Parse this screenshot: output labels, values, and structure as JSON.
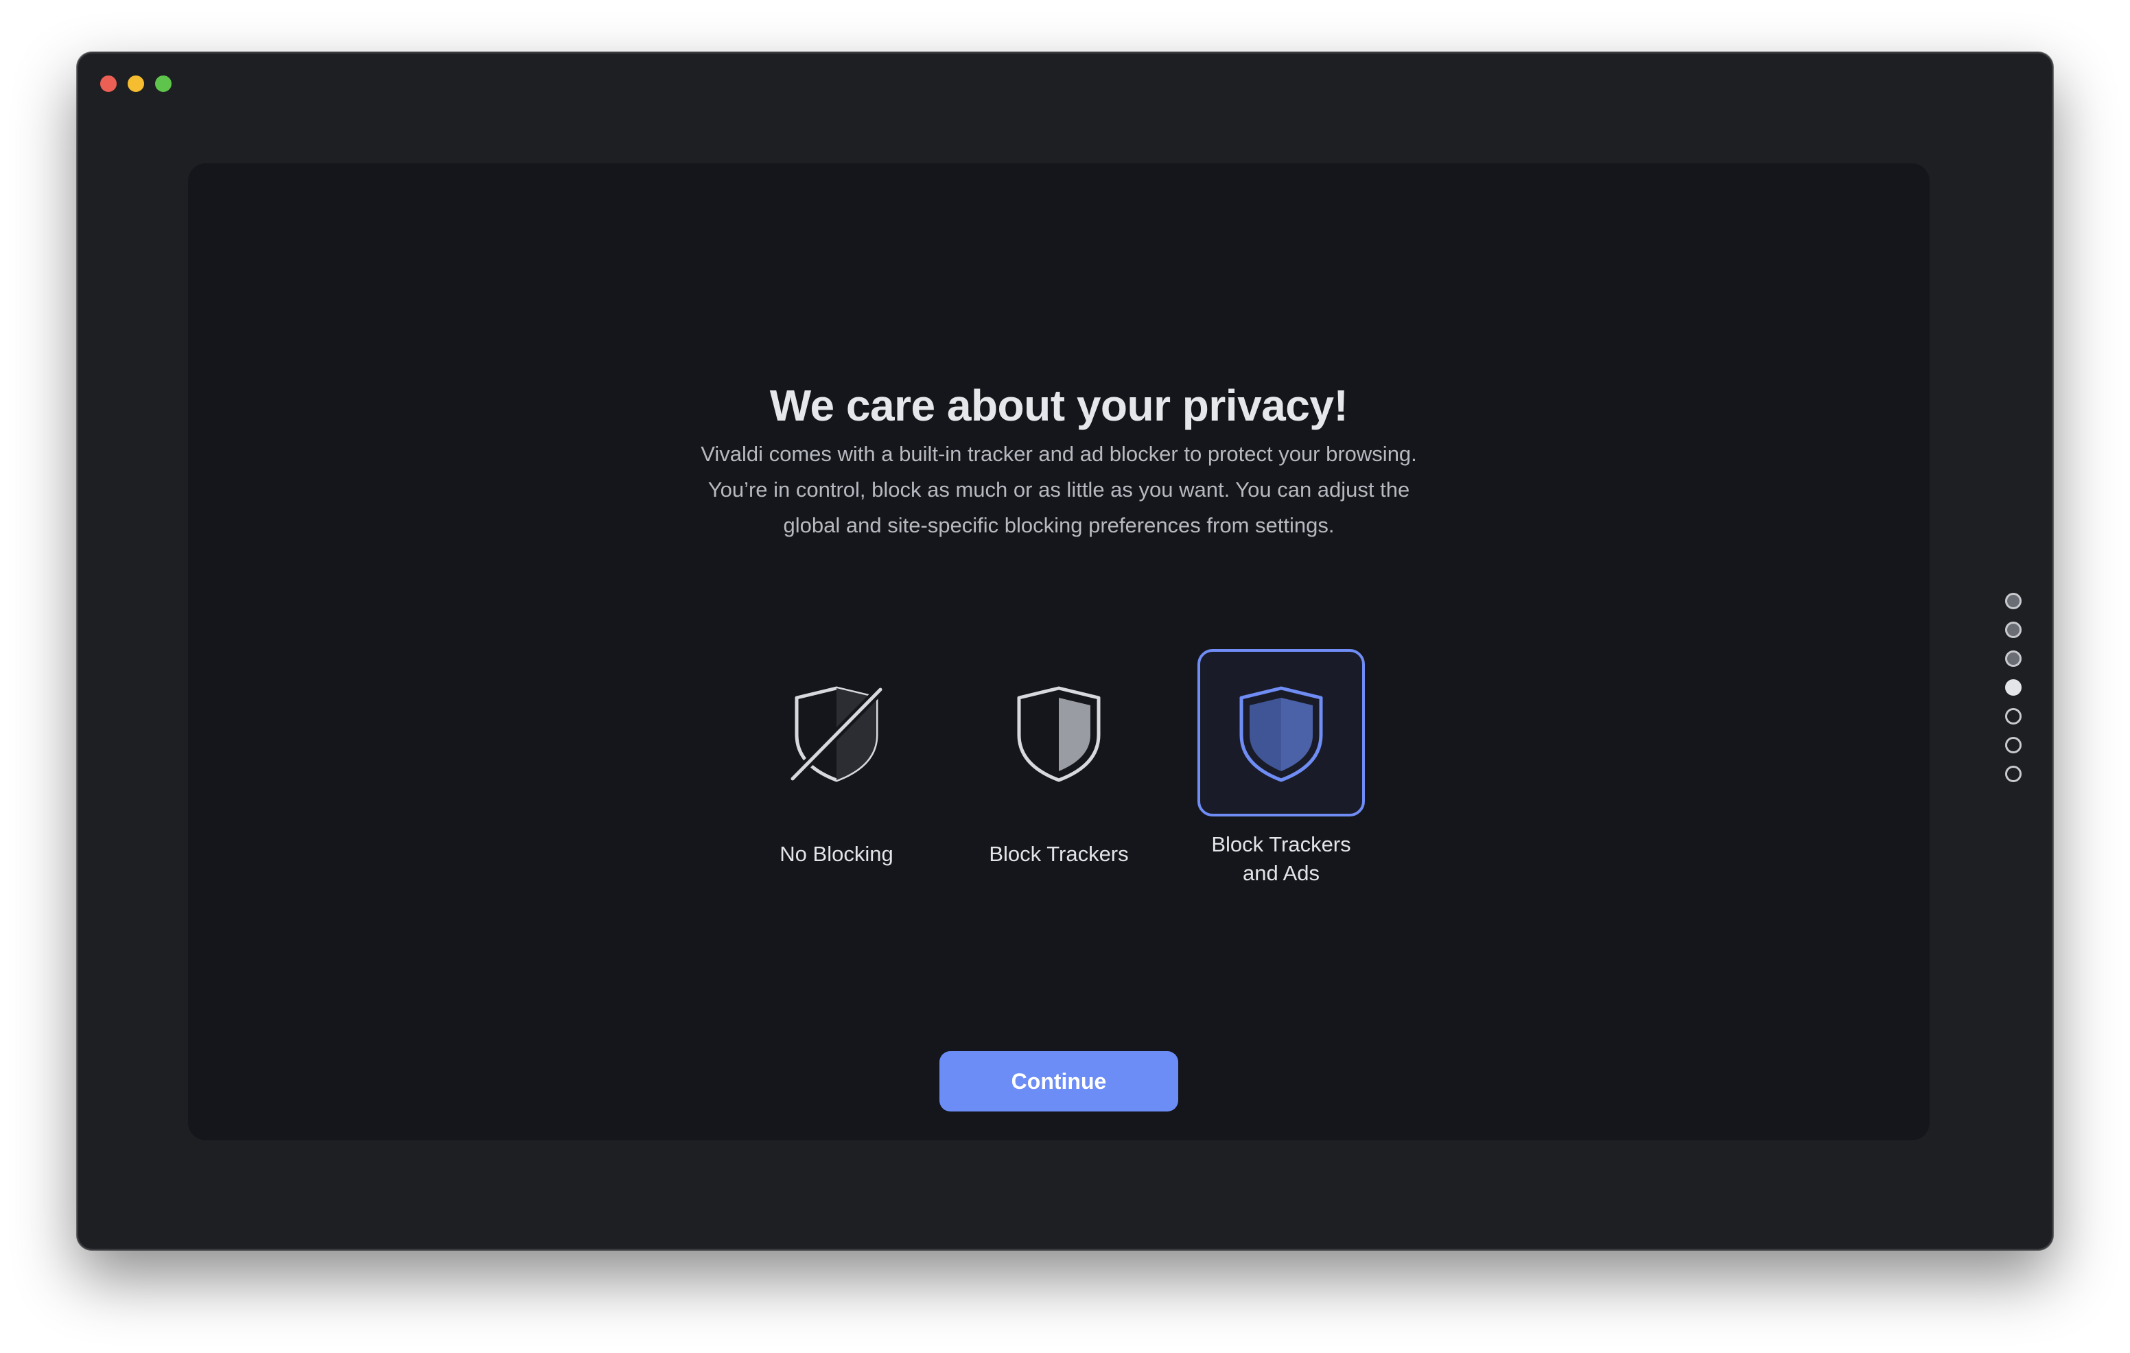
{
  "window": {
    "controls": [
      "close",
      "minimize",
      "maximize"
    ]
  },
  "onboarding": {
    "title": "We care about your privacy!",
    "description": "Vivaldi comes with a built-in tracker and ad blocker to protect your browsing. You’re in control, block as much or as little as you want. You can adjust the global and site-specific blocking preferences from settings.",
    "options": [
      {
        "label": "No Blocking",
        "icon": "shield-slash-icon",
        "selected": false
      },
      {
        "label": "Block Trackers",
        "icon": "shield-half-icon",
        "selected": false
      },
      {
        "label": "Block Trackers and Ads",
        "icon": "shield-full-icon",
        "selected": true
      }
    ],
    "continue_label": "Continue",
    "steps": {
      "total": 7,
      "current": 4
    }
  },
  "colors": {
    "accent": "#6c8df5",
    "window_bg": "#1e1f22",
    "panel_bg": "#15161b"
  }
}
